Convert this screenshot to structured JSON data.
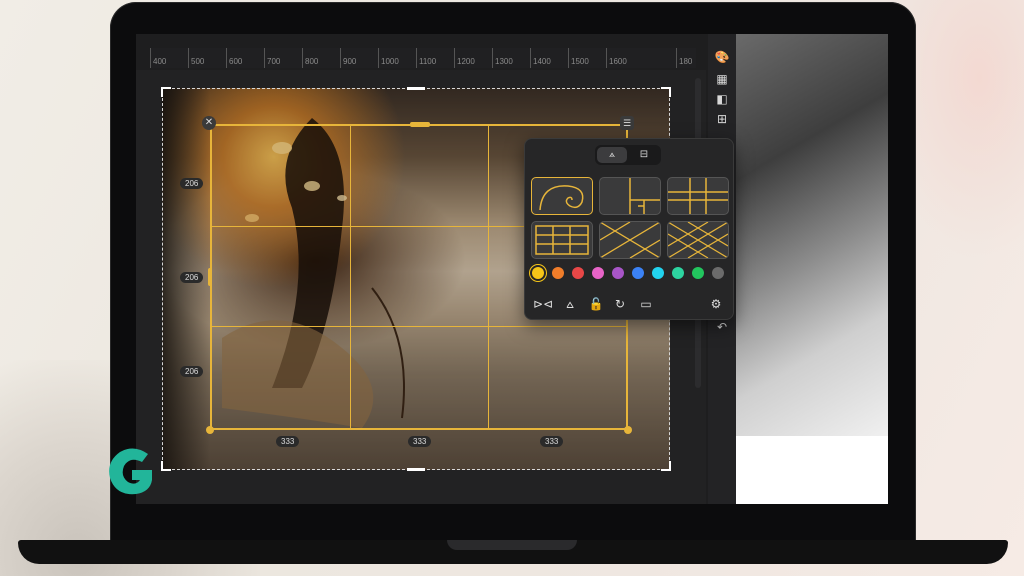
{
  "ruler": {
    "ticks": [
      "400",
      "500",
      "600",
      "700",
      "800",
      "900",
      "1000",
      "1100",
      "1200",
      "1300",
      "1400",
      "1500",
      "1600",
      "180"
    ]
  },
  "dimensions": {
    "row_heights": [
      "206",
      "206",
      "206"
    ],
    "col_widths": [
      "333",
      "333",
      "333"
    ]
  },
  "toolbar": {
    "icons": [
      "palette-icon",
      "grid-icon",
      "gradient-icon",
      "layout-icon",
      "undo-icon"
    ]
  },
  "popup": {
    "tabs": [
      {
        "icon": "overlay-icon",
        "active": true
      },
      {
        "icon": "layout-tab-icon",
        "active": false
      }
    ],
    "overlays": [
      "golden-spiral",
      "golden-ratio",
      "phi-grid",
      "rule-of-thirds",
      "diagonal",
      "triangle"
    ],
    "colors": [
      "#f5c518",
      "#f07d2a",
      "#e84747",
      "#e864c8",
      "#a855c8",
      "#3b82f6",
      "#22d3ee",
      "#2dd4a0",
      "#22c55e",
      "#6b6b6b"
    ],
    "selected_color": "#f5c518",
    "actions": [
      "flip-horizontal-icon",
      "flip-vertical-icon",
      "lock-icon",
      "rotate-icon",
      "display-icon",
      "settings-sliders-icon"
    ]
  },
  "colors": {
    "accent": "#e7b53a",
    "panel": "#262627"
  }
}
